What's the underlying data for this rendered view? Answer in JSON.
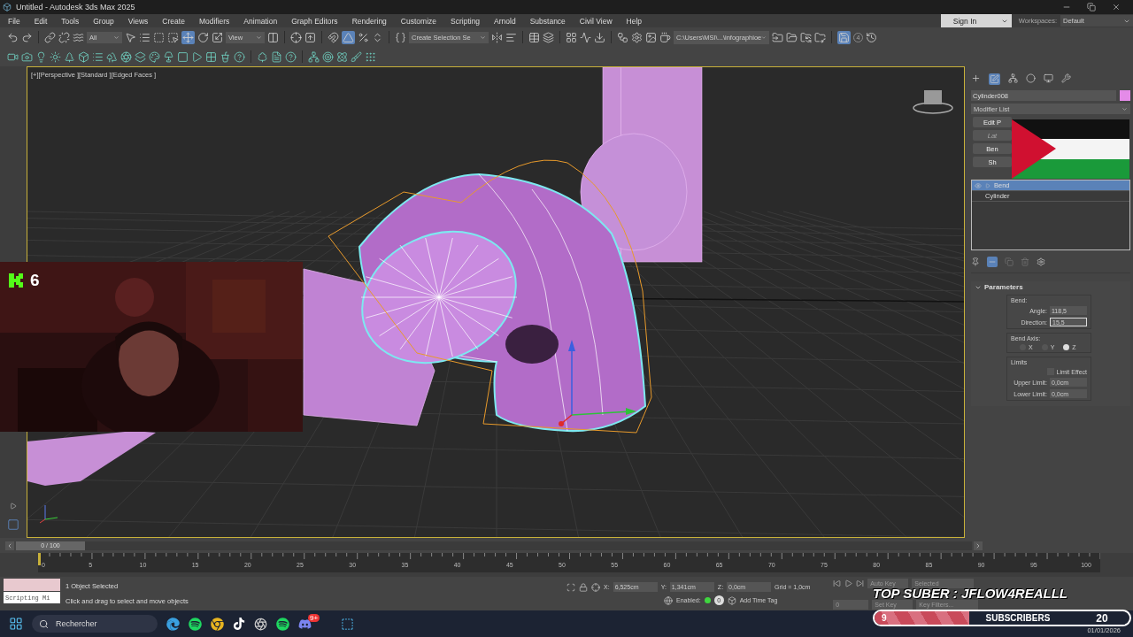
{
  "window": {
    "title": "Untitled - Autodesk 3ds Max 2025"
  },
  "menu": [
    "File",
    "Edit",
    "Tools",
    "Group",
    "Views",
    "Create",
    "Modifiers",
    "Animation",
    "Graph Editors",
    "Rendering",
    "Customize",
    "Scripting",
    "Arnold",
    "Substance",
    "Civil View",
    "Help"
  ],
  "account": {
    "sign_in": "Sign In",
    "workspaces_label": "Workspaces:",
    "workspace": "Default"
  },
  "toolbar": {
    "selection_filter": "All",
    "reference_coord": "View",
    "named_selection": "Create Selection Se",
    "project_path": "C:\\Users\\MSI\\...\\infographioe",
    "autobackup_count": "4"
  },
  "viewport": {
    "label": "[+][Perspective ][Standard ][Edged Faces ]"
  },
  "stream_overlay": {
    "viewer_count": "6",
    "top_suber": "TOP SUBER : JFLOW4REALLL",
    "subscriber_count": "9",
    "subscribers_label": "SUBSCRIBERS",
    "subscriber_goal": "20",
    "level": 0.37
  },
  "command_panel": {
    "object_name": "Cylinder008",
    "modifier_list": "Modifier List",
    "modifier_buttons": [
      {
        "label": "Edit P",
        "disabled": false
      },
      {
        "label": "Lat",
        "disabled": true
      },
      {
        "label": "Ben",
        "disabled": false
      },
      {
        "label": "Sh",
        "disabled": false
      }
    ],
    "stack": [
      {
        "label": "Bend",
        "selected": true
      },
      {
        "label": "Cylinder",
        "selected": false
      }
    ],
    "parameters": {
      "title": "Parameters",
      "bend_group": "Bend:",
      "angle_label": "Angle:",
      "angle": "118,5",
      "direction_label": "Direction:",
      "direction": "15,5",
      "axis_group": "Bend Axis:",
      "axes": [
        {
          "label": "X",
          "selected": false
        },
        {
          "label": "Y",
          "selected": false
        },
        {
          "label": "Z",
          "selected": true
        }
      ],
      "limits_group": "Limits",
      "limit_effect": {
        "label": "Limit Effect",
        "checked": false
      },
      "upper_label": "Upper Limit:",
      "upper": "0,0cm",
      "lower_label": "Lower Limit:",
      "lower": "0,0cm"
    }
  },
  "timeline": {
    "frame": "0 / 100",
    "ticks": [
      "0",
      "5",
      "10",
      "15",
      "20",
      "25",
      "30",
      "35",
      "40",
      "45",
      "50",
      "55",
      "60",
      "65",
      "70",
      "75",
      "80",
      "85",
      "90",
      "95",
      "100"
    ]
  },
  "status": {
    "script_listener": "Scripting Mi",
    "selection": "1 Object Selected",
    "prompt": "Click and drag to select and move objects",
    "x_label": "X:",
    "x": "6,525cm",
    "y_label": "Y:",
    "y": "1,341cm",
    "z_label": "Z:",
    "z": "0,0cm",
    "grid": "Grid = 1,0cm",
    "enabled_label": "Enabled:",
    "enabled_value": "0",
    "add_time_tag": "Add Time Tag",
    "auto_key": "Auto Key",
    "key_mode": "Selected",
    "set_key": "Set Key",
    "key_filters": "Key Filters...",
    "frame_field": "0"
  },
  "taskbar": {
    "search_placeholder": "Rechercher",
    "notification_badge": "9+",
    "date": "01/01/2026"
  }
}
